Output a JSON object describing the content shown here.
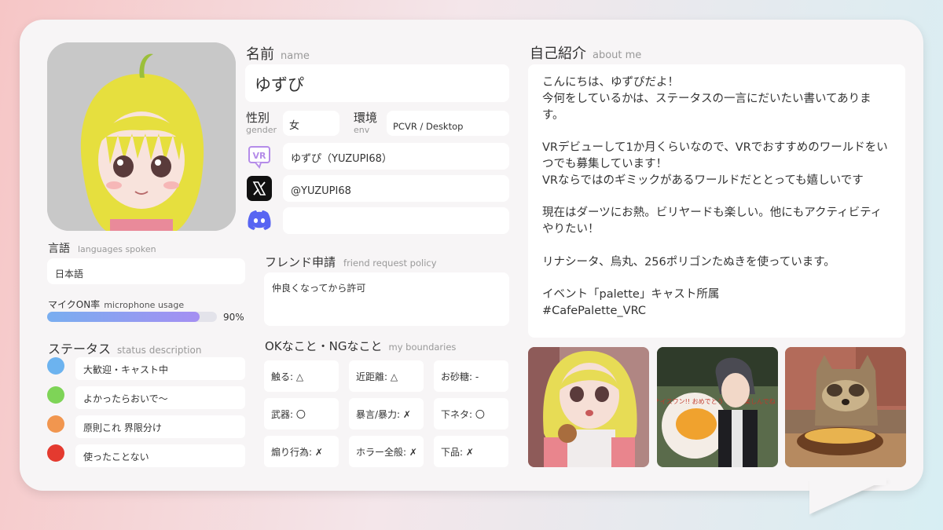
{
  "name": {
    "heading": "名前",
    "heading_en": "name",
    "value": "ゆずぴ"
  },
  "gender": {
    "heading": "性別",
    "heading_en": "gender",
    "value": "女"
  },
  "env": {
    "heading": "環境",
    "heading_en": "env",
    "value": "PCVR / Desktop"
  },
  "accounts": {
    "vrchat": "ゆずぴ（YUZUPI68）",
    "x": "@YUZUPI68",
    "discord": ""
  },
  "languages": {
    "heading": "言語",
    "heading_en": "languages spoken",
    "value": "日本語"
  },
  "mic": {
    "heading": "マイクON率",
    "heading_en": "microphone usage",
    "percent_label": "90%",
    "value": 0.9
  },
  "status": {
    "heading": "ステータス",
    "heading_en": "status description",
    "items": [
      {
        "label": "大歓迎・キャスト中",
        "color": "#6cb3ef"
      },
      {
        "label": "よかったらおいで〜",
        "color": "#7ed457"
      },
      {
        "label": "原則これ 界限分け",
        "color": "#f1964f"
      },
      {
        "label": "使ったことない",
        "color": "#e43a2f"
      }
    ]
  },
  "friend": {
    "heading": "フレンド申請",
    "heading_en": "friend request policy",
    "value": "仲良くなってから許可"
  },
  "boundaries": {
    "heading": "OKなこと・NGなこと",
    "heading_en": "my boundaries",
    "items": [
      "触る: △",
      "近距離: △",
      "お砂糖: -",
      "武器: 〇",
      "暴言/暴力: ✗",
      "下ネタ: 〇",
      "煽り行為: ✗",
      "ホラー全般: ✗",
      "下品: ✗"
    ]
  },
  "about": {
    "heading": "自己紹介",
    "heading_en": "about me",
    "lines": [
      "こんにちは、ゆずぴだよ！",
      "今何をしているかは、ステータスの一言にだいたい書いてあります。",
      "VRデビューして1か月くらいなので、VRでおすすめのワールドをいつでも募集しています！",
      "VRならではのギミックがあるワールドだととっても嬉しいです",
      "現在はダーツにお熱。ビリヤードも楽しい。他にもアクティビティやりたい！",
      "リナシータ、烏丸、256ポリゴンたぬきを使っています。",
      "イベント「palette」キャスト所属",
      "#CafePalette_VRC"
    ]
  },
  "photo_plate_text": "ゆずぴさんへ ナイスワン!! おめでとう ダーツ楽しんでね"
}
